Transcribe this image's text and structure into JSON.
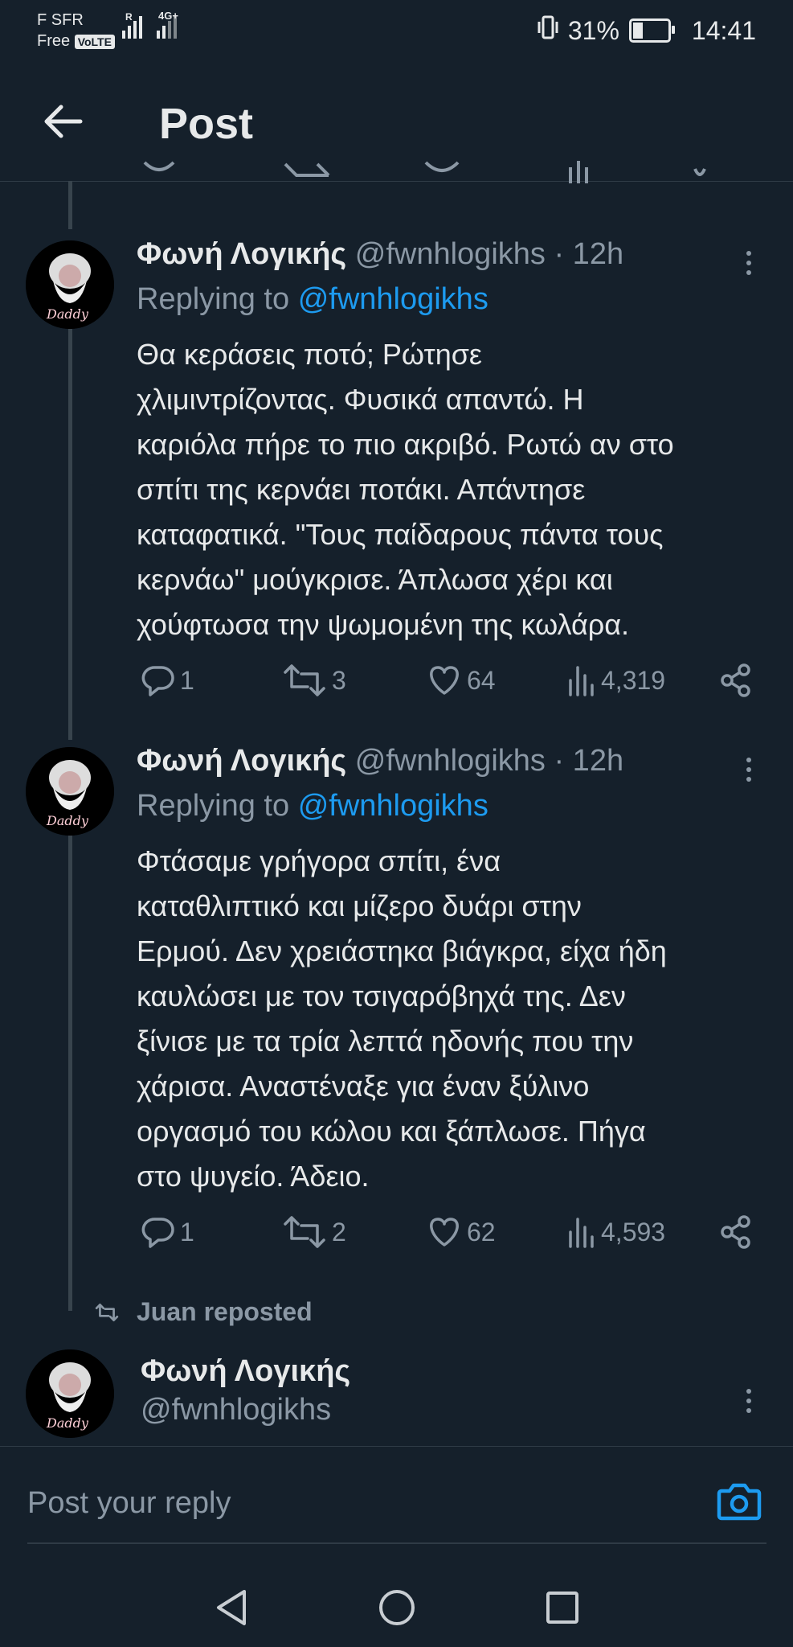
{
  "status_bar": {
    "carrier_line1": "F SFR",
    "carrier_line2": "Free",
    "volte": "VoLTE",
    "net_r": "R",
    "net_4g": "4G+",
    "battery": "31%",
    "battery_level": 0.31,
    "time": "14:41"
  },
  "header": {
    "title": "Post"
  },
  "tweets": [
    {
      "name": "Φωνή Λογικής",
      "handle": "@fwnhlogikhs",
      "time": "· 12h",
      "replying_prefix": "Replying to",
      "replying_handle": "@fwnhlogikhs",
      "text": "Θα κεράσεις ποτό; Ρώτησε\nχλιμιντρίζοντας. Φυσικά απαντώ. Η\nκαριόλα πήρε το πιο ακριβό. Ρωτώ αν στο\nσπίτι της κερνάει ποτάκι. Απάντησε\nκαταφατικά. \"Τους παίδαρους πάντα τους\nκερνάω\" μούγκρισε. Άπλωσα χέρι και\nχούφτωσα την ψωμομένη της κωλάρα.",
      "replies": "1",
      "reposts": "3",
      "likes": "64",
      "views": "4,319"
    },
    {
      "name": "Φωνή Λογικής",
      "handle": "@fwnhlogikhs",
      "time": "· 12h",
      "replying_prefix": "Replying to",
      "replying_handle": "@fwnhlogikhs",
      "text": "Φτάσαμε γρήγορα σπίτι, ένα\nκαταθλιπτικό και μίζερο δυάρι στην\nΕρμού. Δεν χρειάστηκα βιάγκρα, είχα ήδη\nκαυλώσει με τον τσιγαρόβηχά της. Δεν\nξίνισε με τα τρία λεπτά ηδονής που την\nχάρισα. Αναστέναξε για έναν ξύλινο\nοργασμό του κώλου και ξάπλωσε. Πήγα\nστο ψυγείο. Άδειο.",
      "replies": "1",
      "reposts": "2",
      "likes": "62",
      "views": "4,593"
    }
  ],
  "repost_banner": "Juan reposted",
  "reposted_tweet": {
    "name": "Φωνή Λογικής",
    "handle": "@fwnhlogikhs"
  },
  "avatar_caption": "Daddy",
  "composer": {
    "placeholder": "Post your reply"
  },
  "icons": {
    "back": "back-arrow-icon",
    "reply": "reply-icon",
    "repost": "repost-icon",
    "like": "heart-icon",
    "views": "views-icon",
    "share": "share-icon",
    "camera": "camera-icon"
  },
  "colors": {
    "background": "#15202b",
    "accent": "#1d9bf0",
    "muted": "#8b98a5",
    "text": "#e7e9ea"
  }
}
